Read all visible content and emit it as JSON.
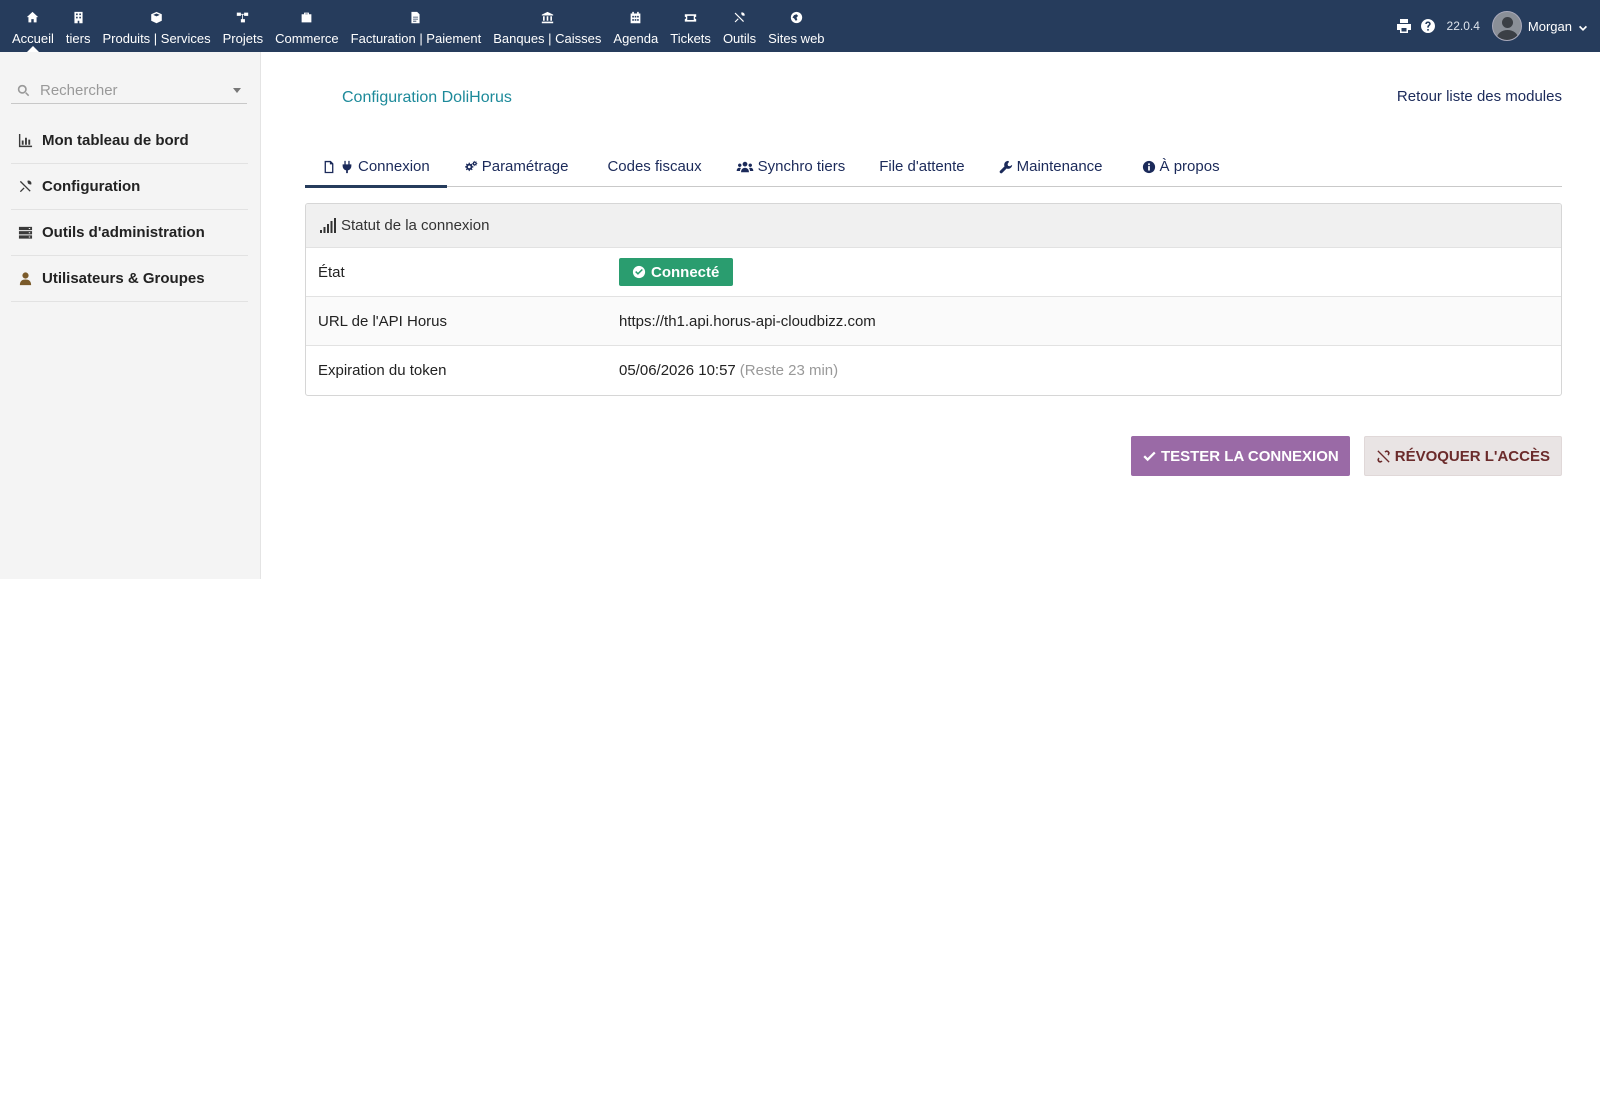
{
  "topmenu": [
    {
      "label": "Accueil",
      "icon": "home-icon"
    },
    {
      "label": "tiers",
      "icon": "building-icon"
    },
    {
      "label": "Produits | Services",
      "icon": "cube-icon"
    },
    {
      "label": "Projets",
      "icon": "sitemap-icon"
    },
    {
      "label": "Commerce",
      "icon": "suitcase-icon"
    },
    {
      "label": "Facturation | Paiement",
      "icon": "invoice-icon"
    },
    {
      "label": "Banques | Caisses",
      "icon": "bank-icon"
    },
    {
      "label": "Agenda",
      "icon": "calendar-icon"
    },
    {
      "label": "Tickets",
      "icon": "ticket-icon"
    },
    {
      "label": "Outils",
      "icon": "tools-icon"
    },
    {
      "label": "Sites web",
      "icon": "globe-icon"
    }
  ],
  "topright": {
    "version": "22.0.4",
    "username": "Morgan"
  },
  "sidebar": {
    "search_placeholder": "Rechercher",
    "items": [
      {
        "label": "Mon tableau de bord",
        "icon": "chart-bar-icon"
      },
      {
        "label": "Configuration",
        "icon": "tools-icon"
      },
      {
        "label": "Outils d'administration",
        "icon": "server-icon"
      },
      {
        "label": "Utilisateurs & Groupes",
        "icon": "user-icon"
      }
    ]
  },
  "main": {
    "title": "Configuration DoliHorus",
    "back_link": "Retour liste des modules",
    "tabs": [
      {
        "label": "Connexion",
        "icon": "plug-icon",
        "active": true
      },
      {
        "label": "Paramétrage",
        "icon": "cogs-icon"
      },
      {
        "label": "Codes fiscaux",
        "icon": ""
      },
      {
        "label": "Synchro tiers",
        "icon": "users-icon"
      },
      {
        "label": "File d'attente",
        "icon": ""
      },
      {
        "label": "Maintenance",
        "icon": "wrench-icon"
      },
      {
        "label": "À propos",
        "icon": "info-circle-icon"
      }
    ],
    "panel": {
      "title": "Statut de la connexion",
      "rows": [
        {
          "label": "État",
          "badge": "Connecté"
        },
        {
          "label": "URL de l'API Horus",
          "value": "https://th1.api.horus-api-cloudbizz.com"
        },
        {
          "label": "Expiration du token",
          "value": "05/06/2026 10:57",
          "note": "(Reste 23 min)"
        }
      ]
    },
    "buttons": {
      "test": "Tester la connexion",
      "revoke": "Révoquer l'accès"
    }
  },
  "colors": {
    "topbar": "#263c5c",
    "accent_title": "#1d8a9a",
    "status_connected": "#2a9d6f",
    "button_primary": "#9a6aa6",
    "button_danger_bg": "#e9e4e4"
  }
}
